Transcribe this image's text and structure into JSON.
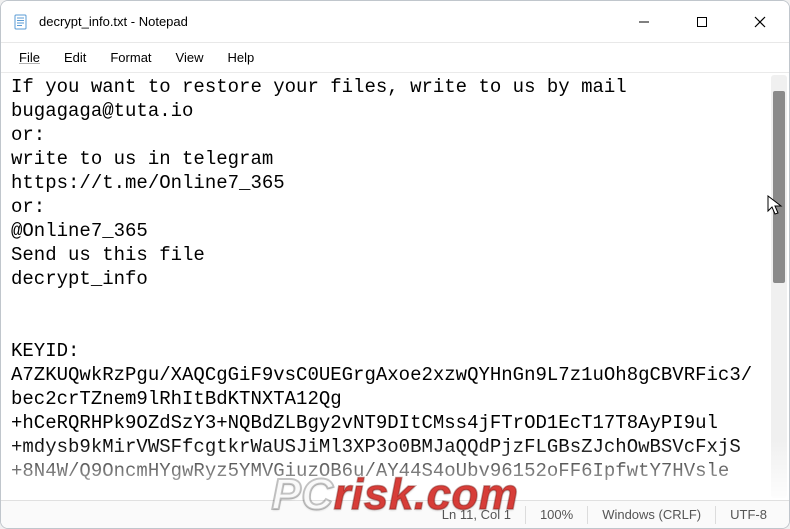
{
  "title": "decrypt_info.txt - Notepad",
  "menu": {
    "file": "File",
    "edit": "Edit",
    "format": "Format",
    "view": "View",
    "help": "Help"
  },
  "content": "If you want to restore your files, write to us by mail\nbugagaga@tuta.io\nor:\nwrite to us in telegram\nhttps://t.me/Online7_365\nor:\n@Online7_365\nSend us this file\ndecrypt_info\n\n\nKEYID:\nA7ZKUQwkRzPgu/XAQCgGiF9vsC0UEGrgAxoe2xzwQYHnGn9L7z1uOh8gCBVRFic3/\nbec2crTZnem9lRhItBdKTNXTA12Qg\n+hCeRQRHPk9OZdSzY3+NQBdZLBgy2vNT9DItCMss4jFTrOD1EcT17T8AyPI9ul\n+mdysb9kMirVWSFfcgtkrWaUSJiMl3XP3o0BMJaQQdPjzFLGBsZJchOwBSVcFxjS\n+8N4W/Q9OncmHYgwRyz5YMVGiuzOB6u/AY44S4oUbv96152oFF6IpfwtY7HVsle",
  "status": {
    "position": "Ln 11, Col 1",
    "zoom": "100%",
    "line_ending": "Windows (CRLF)",
    "encoding": "UTF-8"
  },
  "watermark": {
    "left": "PC",
    "right": "risk.com"
  }
}
